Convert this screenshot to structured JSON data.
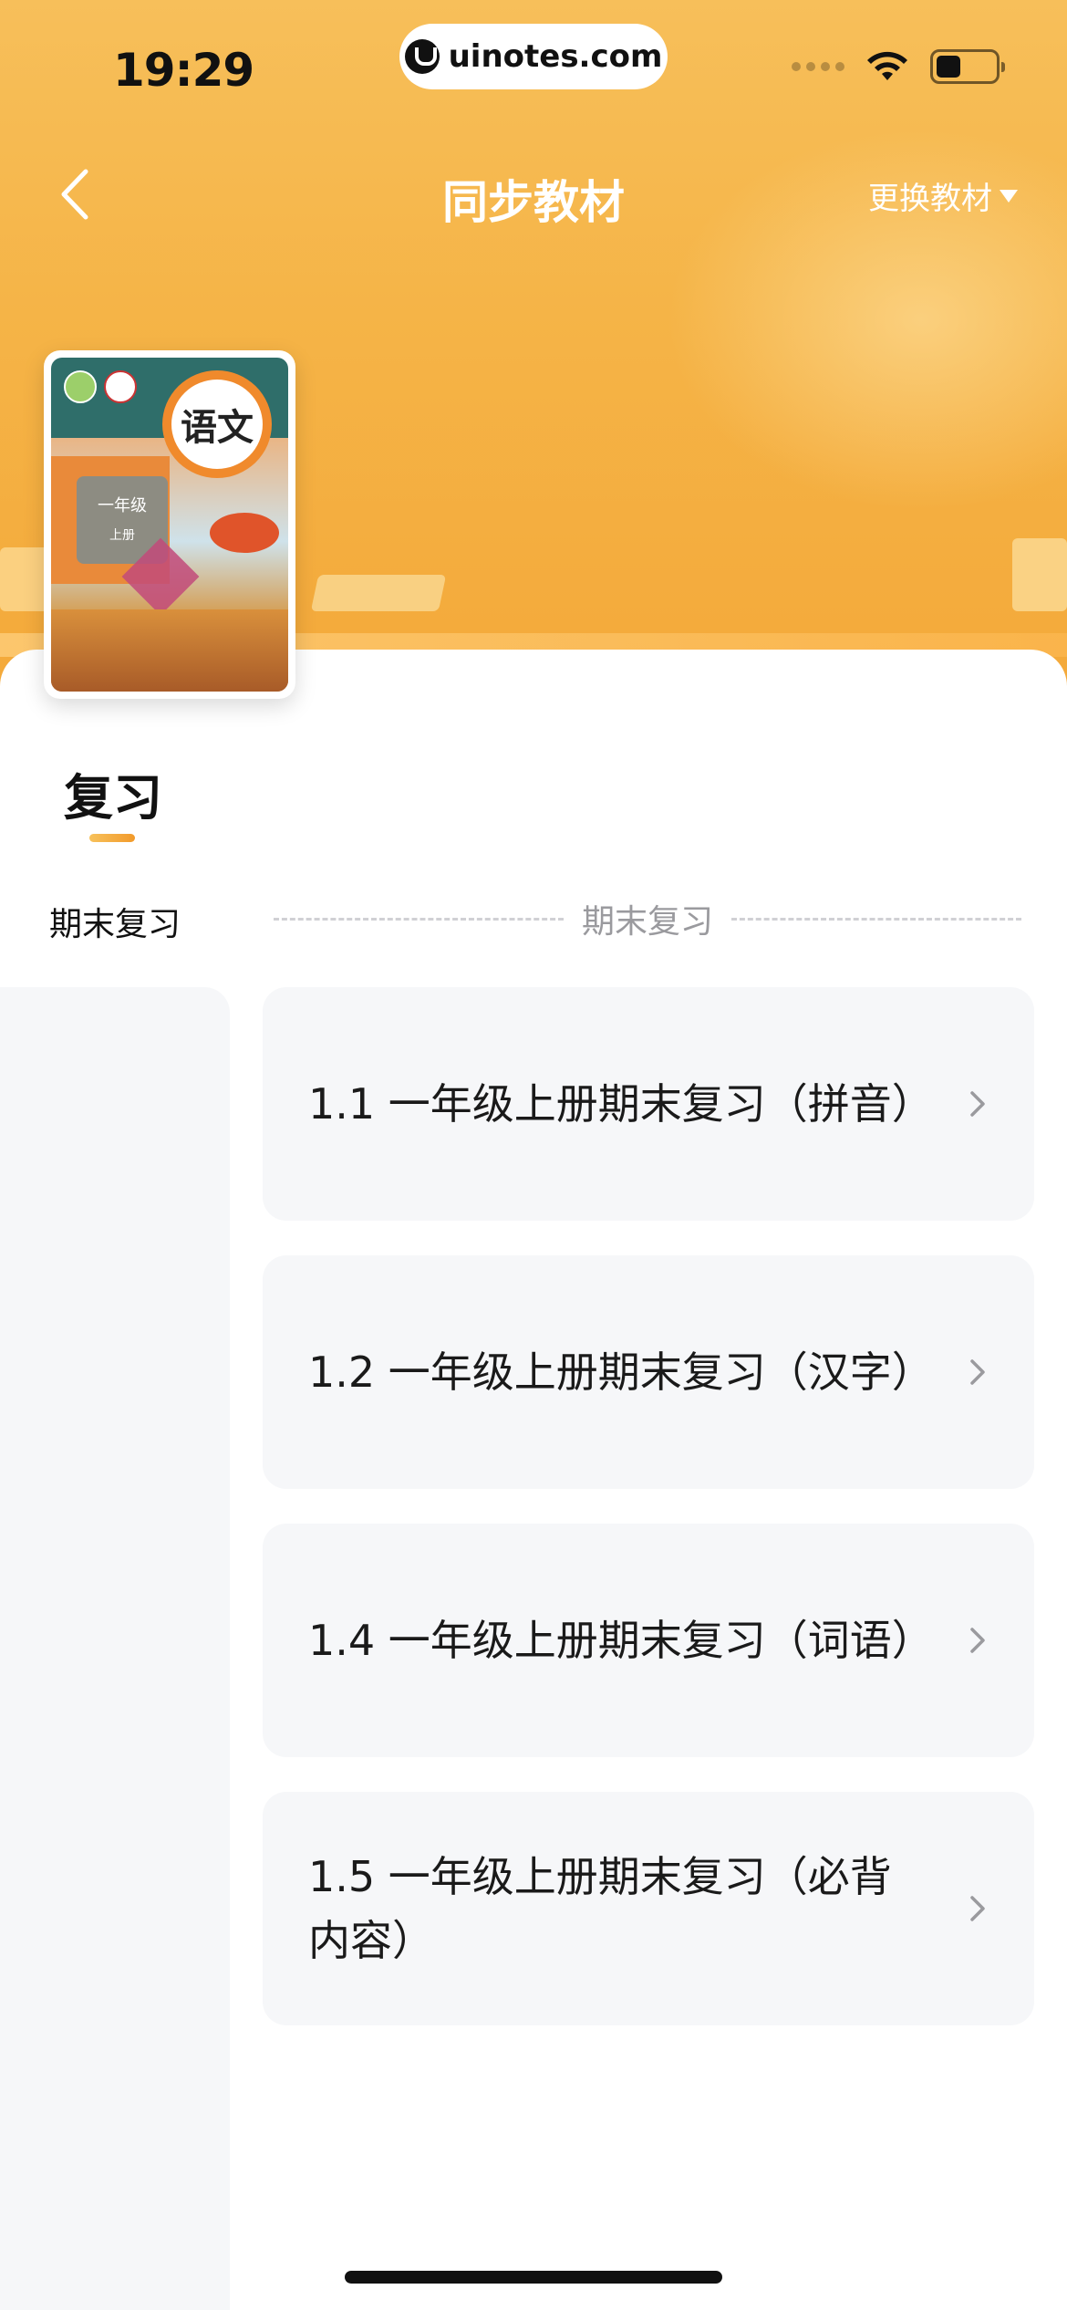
{
  "status_bar": {
    "time": "19:29",
    "url": "uinotes.com"
  },
  "nav": {
    "title": "同步教材",
    "switch_label": "更换教材"
  },
  "book": {
    "cover_title": "语文",
    "grade": "一年级",
    "volume": "上册"
  },
  "section": {
    "title": "复习",
    "left_label": "期末复习",
    "divider_label": "期末复习"
  },
  "items": [
    {
      "label": "1.1 一年级上册期末复习（拼音）"
    },
    {
      "label": "1.2 一年级上册期末复习（汉字）"
    },
    {
      "label": "1.4 一年级上册期末复习（词语）"
    },
    {
      "label": "1.5 一年级上册期末复习（必背内容）"
    }
  ],
  "colors": {
    "accent": "#f5b447",
    "card_bg": "#f6f7f9"
  }
}
